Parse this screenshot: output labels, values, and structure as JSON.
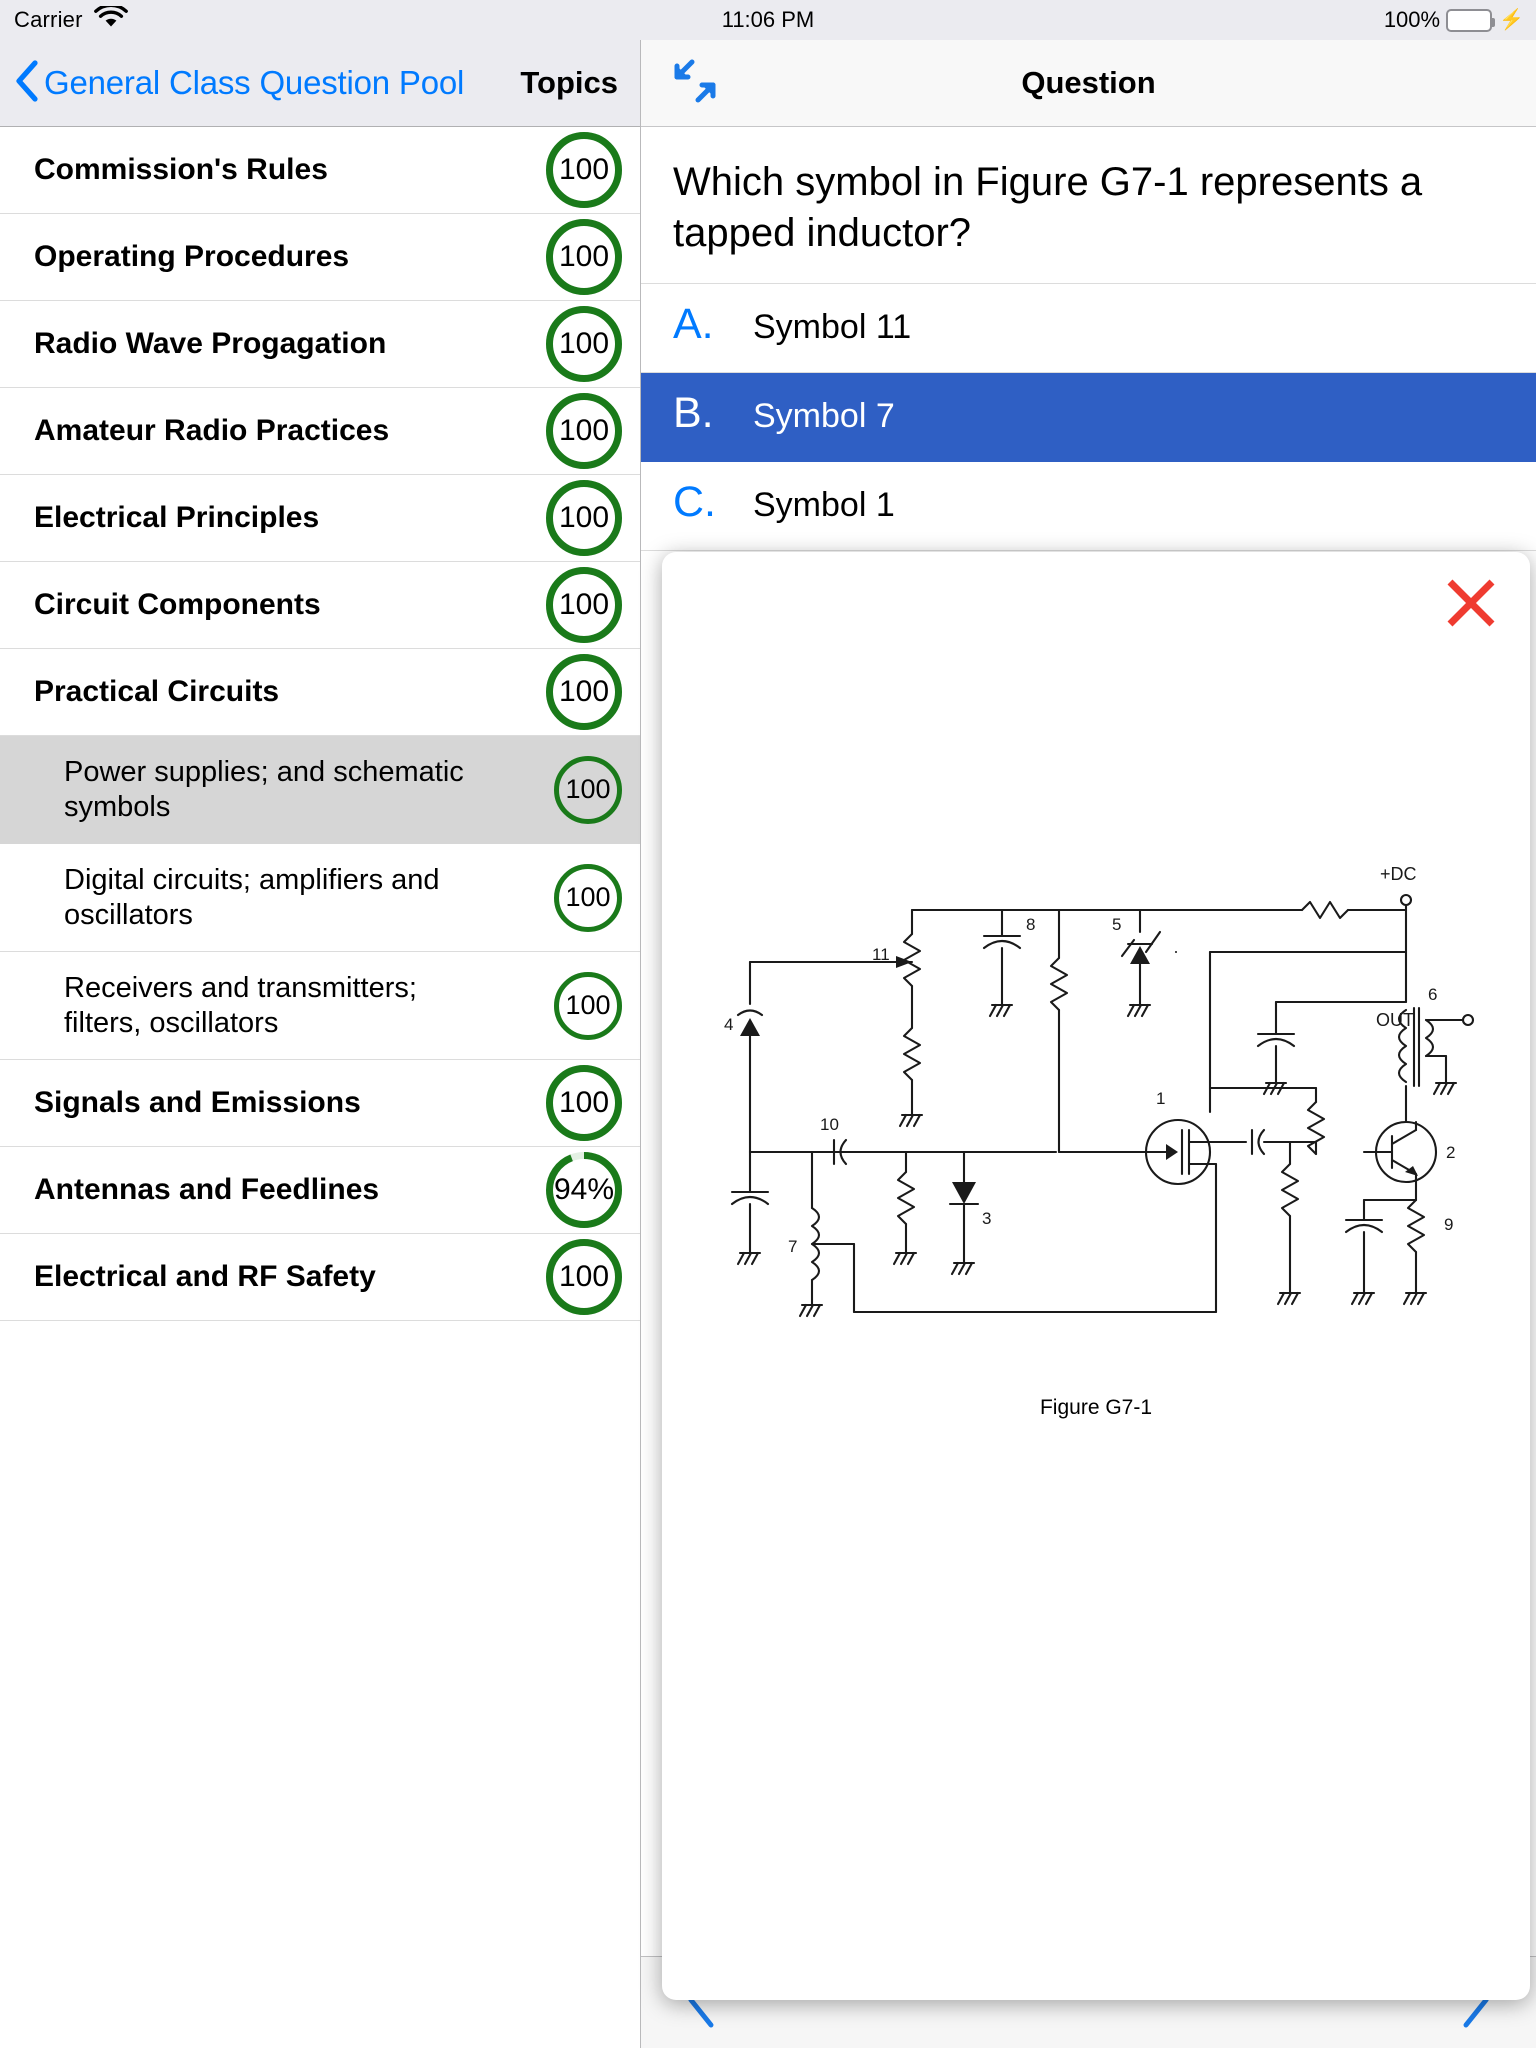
{
  "statusbar": {
    "carrier": "Carrier",
    "wifi_icon": "wifi-icon",
    "time": "11:06 PM",
    "battery_percent": "100%",
    "battery_icon": "battery-full-icon",
    "charging_icon": "lightning-bolt-icon"
  },
  "master": {
    "back_icon": "chevron-left-icon",
    "back_label": "General Class Question Pool",
    "title": "Topics",
    "topics": [
      {
        "label": "Commission's Rules",
        "badge": "100",
        "percent": 100,
        "level": 1,
        "selected": false
      },
      {
        "label": "Operating Procedures",
        "badge": "100",
        "percent": 100,
        "level": 1,
        "selected": false
      },
      {
        "label": "Radio Wave Progagation",
        "badge": "100",
        "percent": 100,
        "level": 1,
        "selected": false
      },
      {
        "label": "Amateur Radio Practices",
        "badge": "100",
        "percent": 100,
        "level": 1,
        "selected": false
      },
      {
        "label": "Electrical Principles",
        "badge": "100",
        "percent": 100,
        "level": 1,
        "selected": false
      },
      {
        "label": "Circuit Components",
        "badge": "100",
        "percent": 100,
        "level": 1,
        "selected": false
      },
      {
        "label": "Practical Circuits",
        "badge": "100",
        "percent": 100,
        "level": 1,
        "selected": false
      },
      {
        "label": "Power supplies; and schematic symbols",
        "badge": "100",
        "percent": 100,
        "level": 2,
        "selected": true
      },
      {
        "label": "Digital circuits; amplifiers and oscillators",
        "badge": "100",
        "percent": 100,
        "level": 2,
        "selected": false
      },
      {
        "label": "Receivers and transmitters; filters, oscillators",
        "badge": "100",
        "percent": 100,
        "level": 2,
        "selected": false
      },
      {
        "label": "Signals and Emissions",
        "badge": "100",
        "percent": 100,
        "level": 1,
        "selected": false
      },
      {
        "label": "Antennas and Feedlines",
        "badge": "94%",
        "percent": 94,
        "level": 1,
        "selected": false
      },
      {
        "label": "Electrical and RF Safety",
        "badge": "100",
        "percent": 100,
        "level": 1,
        "selected": false
      }
    ],
    "badge_ring_color": "#1a7a1a"
  },
  "detail": {
    "expand_icon": "expand-diagonal-icon",
    "title": "Question",
    "question": "Which symbol in Figure G7-1 represents a tapped inductor?",
    "answers": [
      {
        "letter": "A.",
        "text": "Symbol 11",
        "selected": false
      },
      {
        "letter": "B.",
        "text": "Symbol 7",
        "selected": true
      },
      {
        "letter": "C.",
        "text": "Symbol 1",
        "selected": false
      }
    ],
    "selection_color": "#2f5fc4",
    "accent_color": "#007aff",
    "toolbar": {
      "previous_icon": "chevron-left-icon",
      "next_icon": "chevron-right-icon"
    }
  },
  "modal": {
    "close_icon": "close-x-icon",
    "close_color": "#ef3b30",
    "figure": {
      "caption": "Figure G7-1",
      "supply_label": "+DC",
      "output_label": "OUT",
      "component_numbers": [
        "1",
        "2",
        "3",
        "4",
        "5",
        "6",
        "7",
        "8",
        "9",
        "10",
        "11"
      ]
    }
  }
}
